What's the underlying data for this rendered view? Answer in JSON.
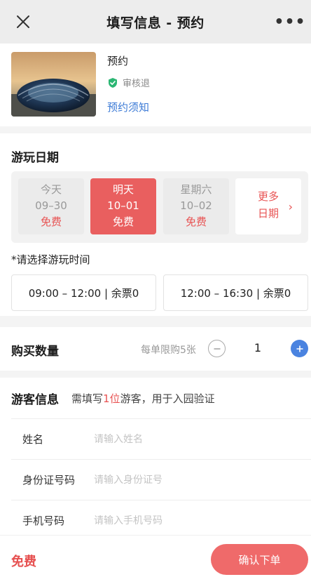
{
  "header": {
    "title": "填写信息 - 预约",
    "close_icon": "close-icon",
    "more_label": "•••"
  },
  "product": {
    "name": "预约",
    "status": "审核退",
    "notice_link": "预约须知"
  },
  "date_section": {
    "title": "游玩日期",
    "dates": [
      {
        "day": "今天",
        "date": "09–30",
        "price": "免费"
      },
      {
        "day": "明天",
        "date": "10–01",
        "price": "免费"
      },
      {
        "day": "星期六",
        "date": "10–02",
        "price": "免费"
      }
    ],
    "selected_index": 1,
    "more": {
      "line1": "更多",
      "line2": "日期",
      "chevron": "›"
    },
    "time_label": "*请选择游玩时间",
    "slots": [
      {
        "label": "09:00 – 12:00 | 余票0"
      },
      {
        "label": "12:00 – 16:30 | 余票0"
      }
    ]
  },
  "quantity": {
    "title": "购买数量",
    "limit_text": "每单限购5张",
    "count": "1"
  },
  "visitor": {
    "title": "游客信息",
    "hint_prefix": "需填写",
    "hint_count": "1位",
    "hint_suffix": "游客，用于入园验证",
    "fields": [
      {
        "label": "姓名",
        "placeholder": "请输入姓名"
      },
      {
        "label": "身份证号码",
        "placeholder": "请输入身份证号"
      },
      {
        "label": "手机号码",
        "placeholder": "请输入手机号码"
      }
    ]
  },
  "bottom": {
    "total": "免费",
    "confirm_label": "确认下单"
  },
  "colors": {
    "accent_red": "#e95f5f",
    "link_blue": "#3d7bd6",
    "plus_blue": "#4a83e0",
    "check_green": "#2bb673"
  }
}
